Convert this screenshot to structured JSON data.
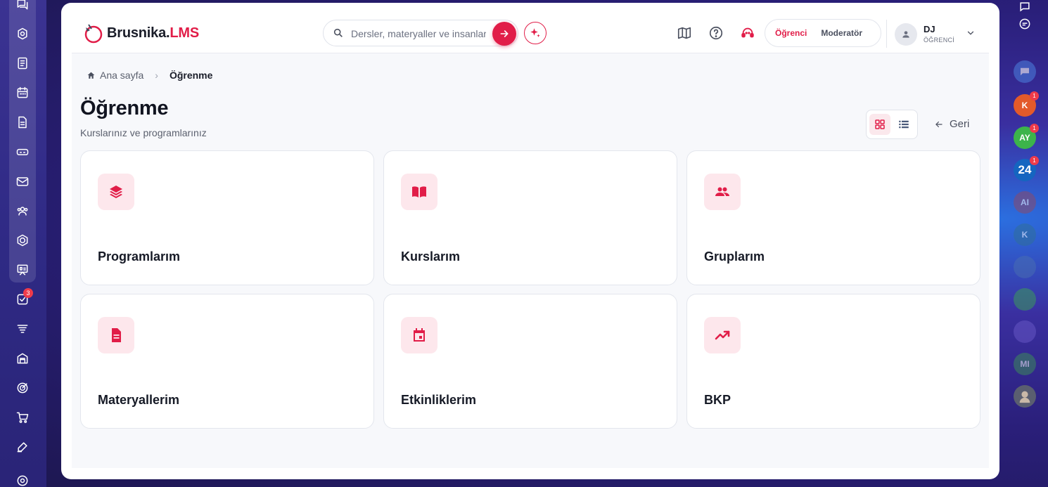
{
  "app": {
    "name_main": "Brusnika.",
    "name_accent": "LMS"
  },
  "search": {
    "placeholder": "Dersler, materyaller ve insanlar"
  },
  "roles": [
    {
      "label": "Öğrenci",
      "active": true
    },
    {
      "label": "Moderatör",
      "active": false
    }
  ],
  "user": {
    "initials": "DJ",
    "role": "ÖĞRENCİ"
  },
  "breadcrumb": {
    "home": "Ana sayfa",
    "current": "Öğrenme"
  },
  "page": {
    "title": "Öğrenme",
    "subtitle": "Kurslarınız ve programlarınız",
    "back_label": "Geri"
  },
  "tiles": [
    {
      "label": "Programlarım",
      "icon": "layers-icon"
    },
    {
      "label": "Kurslarım",
      "icon": "book-icon"
    },
    {
      "label": "Gruplarım",
      "icon": "group-icon"
    },
    {
      "label": "Materyallerim",
      "icon": "document-icon"
    },
    {
      "label": "Etkinliklerim",
      "icon": "calendar-icon"
    },
    {
      "label": "BKP",
      "icon": "trending-up-icon"
    }
  ],
  "left_rail": {
    "task_badge": "3"
  },
  "right_rail": [
    {
      "initials": "K",
      "badge": "1",
      "color": "#e35a2a"
    },
    {
      "initials": "AY",
      "badge": "1",
      "color": "#3cb44b"
    },
    {
      "initials": "24",
      "badge": "1",
      "color": "#1565c0"
    },
    {
      "initials": "AI",
      "badge": "",
      "color": "#8a4a6a"
    },
    {
      "initials": "K",
      "badge": "",
      "color": "#2f6f9a"
    },
    {
      "initials": "MI",
      "badge": "",
      "color": "#3c8a5a"
    }
  ],
  "colors": {
    "accent": "#e11d48",
    "tile_icon_bg": "#fde7ec"
  }
}
